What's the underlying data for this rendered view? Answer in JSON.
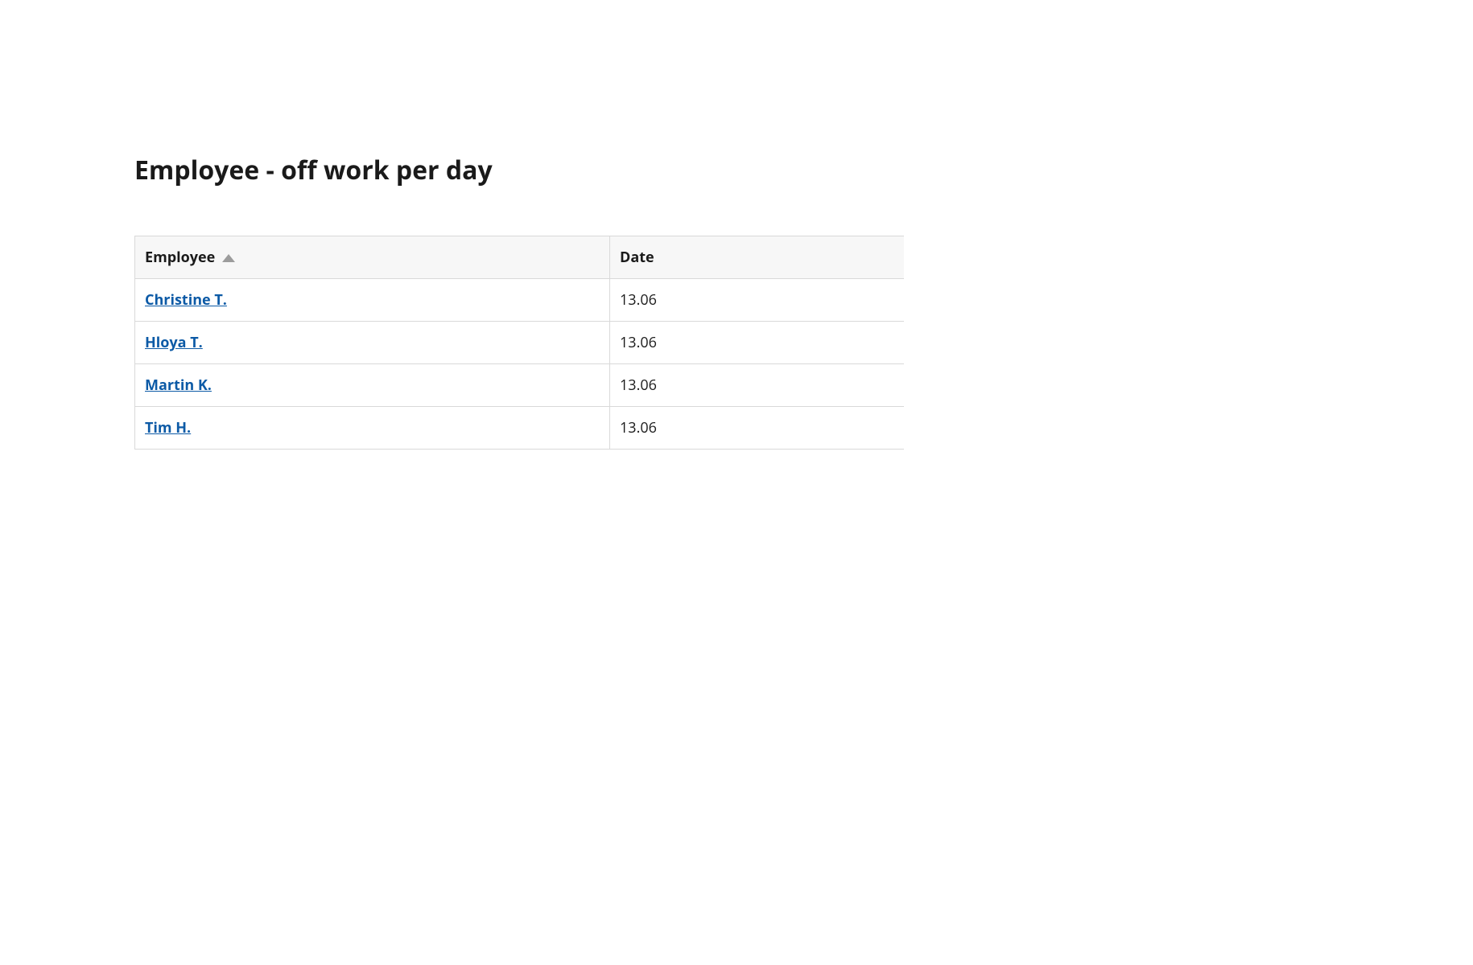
{
  "title": "Employee - off work per day",
  "table": {
    "headers": {
      "employee": "Employee",
      "date": "Date"
    },
    "sort": {
      "column": "employee",
      "direction": "desc"
    },
    "rows": [
      {
        "employee": "Christine T.",
        "date": "13.06"
      },
      {
        "employee": "Hloya T.",
        "date": "13.06"
      },
      {
        "employee": "Martin K.",
        "date": "13.06"
      },
      {
        "employee": "Tim H.",
        "date": "13.06"
      }
    ]
  }
}
